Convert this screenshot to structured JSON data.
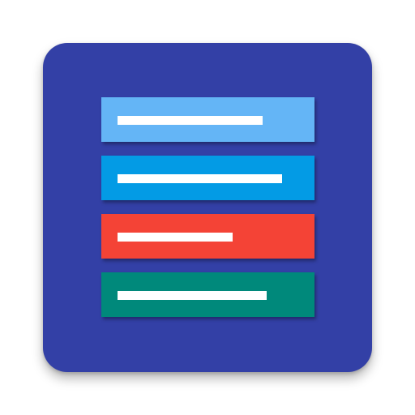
{
  "icon": {
    "name": "list-icon",
    "background_color": "#3340a6",
    "items": [
      {
        "color": "#64b5f6",
        "line_fraction": 0.68
      },
      {
        "color": "#039be5",
        "line_fraction": 0.77
      },
      {
        "color": "#f44336",
        "line_fraction": 0.54
      },
      {
        "color": "#00897b",
        "line_fraction": 0.7
      }
    ]
  }
}
